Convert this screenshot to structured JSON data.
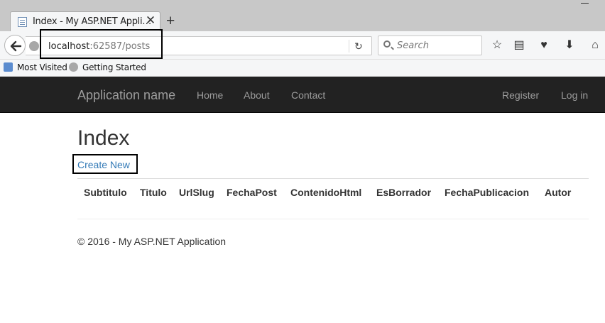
{
  "browser": {
    "tab_title": "Index - My ASP.NET Appli…",
    "tab_close": "✕",
    "new_tab": "+",
    "url_host": "localhost",
    "url_rest": ":62587/posts",
    "search_placeholder": "Search",
    "bookmarks": [
      "Most Visited",
      "Getting Started"
    ],
    "toolbar_icons": [
      "star-icon",
      "reading-list-icon",
      "pocket-icon",
      "download-icon",
      "home-icon"
    ]
  },
  "site": {
    "brand": "Application name",
    "nav_left": [
      "Home",
      "About",
      "Contact"
    ],
    "nav_right": [
      "Register",
      "Log in"
    ],
    "colors": {
      "navbar_bg": "#222222",
      "nav_text": "#9d9d9d",
      "link": "#337ab7"
    }
  },
  "page": {
    "title": "Index",
    "create_link": "Create New",
    "table_headers": [
      "Subtitulo",
      "Titulo",
      "UrlSlug",
      "FechaPost",
      "ContenidoHtml",
      "EsBorrador",
      "FechaPublicacion",
      "Autor"
    ],
    "footer": "© 2016 - My ASP.NET Application"
  }
}
